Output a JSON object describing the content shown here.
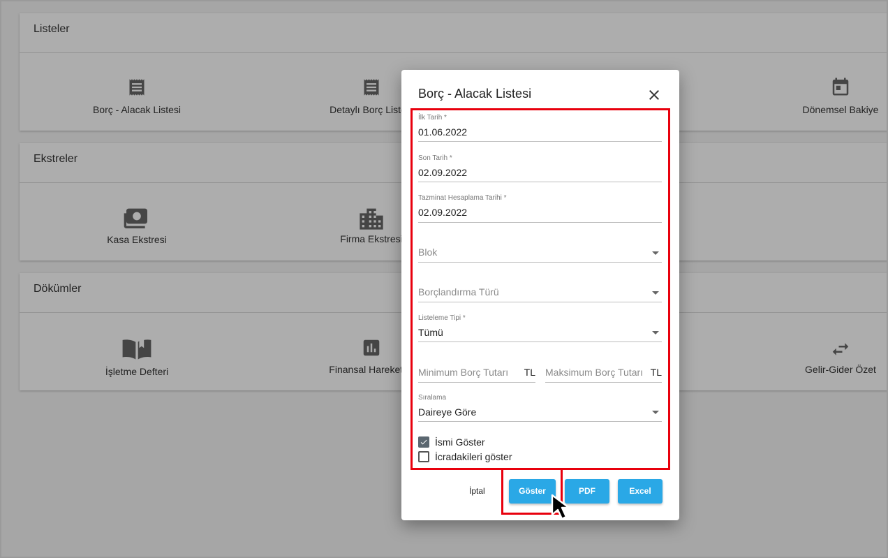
{
  "sections": {
    "listeler": {
      "title": "Listeler",
      "tiles": [
        "Borç - Alacak Listesi",
        "Detaylı Borç Listesi",
        "Dönemsel Bakiye"
      ]
    },
    "ekstreler": {
      "title": "Ekstreler",
      "tiles": [
        "Kasa Ekstresi",
        "Firma Ekstresi"
      ]
    },
    "dokumler": {
      "title": "Dökümler",
      "tiles": [
        "İşletme Defteri",
        "Finansal Hareketler",
        "Gelir-Gider Özet"
      ]
    }
  },
  "dialog": {
    "title": "Borç - Alacak Listesi",
    "fields": {
      "ilk_tarih": {
        "label": "İlk Tarih *",
        "value": "01.06.2022"
      },
      "son_tarih": {
        "label": "Son Tarih *",
        "value": "02.09.2022"
      },
      "tazminat_tarihi": {
        "label": "Tazminat Hesaplama Tarihi *",
        "value": "02.09.2022"
      },
      "blok": {
        "placeholder": "Blok"
      },
      "borclandirma_turu": {
        "placeholder": "Borçlandırma Türü"
      },
      "listeleme_tipi": {
        "label": "Listeleme Tipi *",
        "value": "Tümü"
      },
      "min_borc": {
        "placeholder": "Minimum Borç Tutarı",
        "suffix": "TL"
      },
      "max_borc": {
        "placeholder": "Maksimum Borç Tutarı",
        "suffix": "TL"
      },
      "siralama": {
        "label": "Sıralama",
        "value": "Daireye Göre"
      }
    },
    "checkboxes": {
      "ismi_goster": {
        "label": "İsmi Göster",
        "checked": true
      },
      "icradakileri_goster": {
        "label": "İcradakileri göster",
        "checked": false
      }
    },
    "buttons": {
      "iptal": "İptal",
      "goster": "Göster",
      "pdf": "PDF",
      "excel": "Excel"
    }
  },
  "colors": {
    "accent": "#2aa8e6",
    "highlight": "#e8000d",
    "overlay": "rgba(0,0,0,0.32)"
  }
}
